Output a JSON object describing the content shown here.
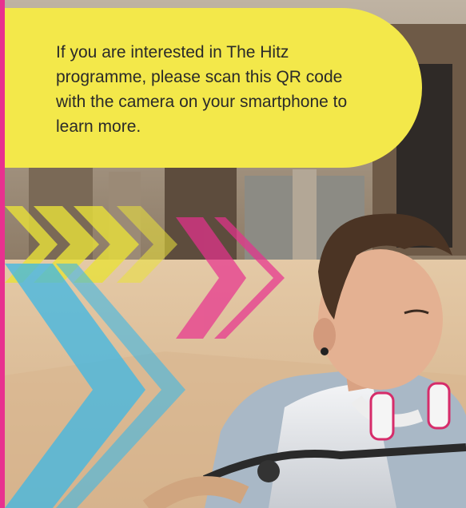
{
  "callout": {
    "text": "If you are interested in The Hitz programme, please scan this QR code with the camera on your smartphone to learn more."
  },
  "colors": {
    "callout_background": "#f3e84a",
    "accent_pink": "#e8318f",
    "accent_cyan": "#3db8e6",
    "accent_yellow": "#e9e13a"
  },
  "photo": {
    "icon": "young-man-on-bicycle-photo"
  }
}
